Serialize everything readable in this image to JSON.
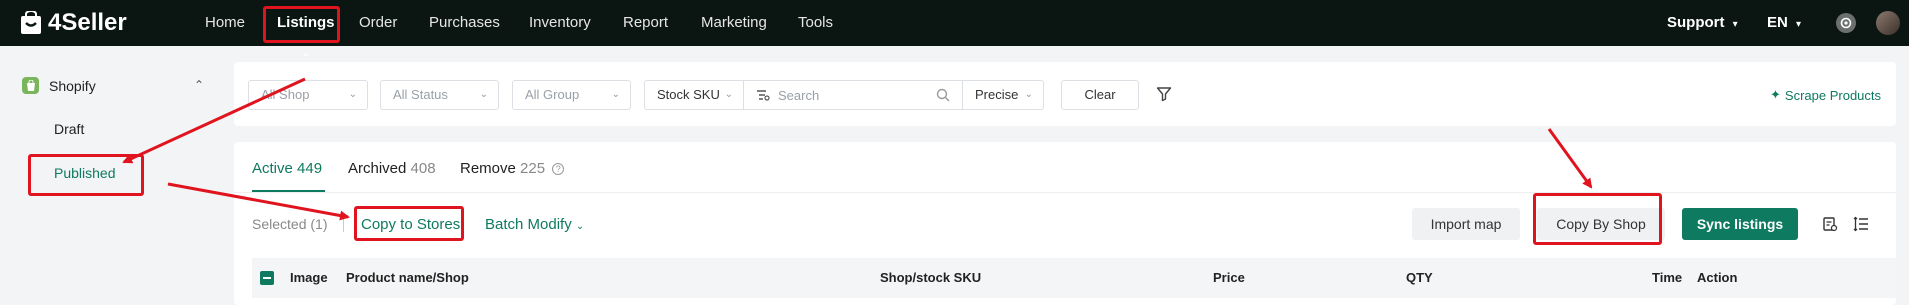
{
  "app": {
    "name": "4Seller"
  },
  "topnav": {
    "items": [
      {
        "label": "Home"
      },
      {
        "label": "Listings"
      },
      {
        "label": "Order"
      },
      {
        "label": "Purchases"
      },
      {
        "label": "Inventory"
      },
      {
        "label": "Report"
      },
      {
        "label": "Marketing"
      },
      {
        "label": "Tools"
      }
    ],
    "active": "Listings",
    "support_label": "Support",
    "language_label": "EN"
  },
  "sidebar": {
    "platform": "Shopify",
    "items": [
      {
        "label": "Draft"
      },
      {
        "label": "Published"
      }
    ],
    "active": "Published"
  },
  "filters": {
    "shop": "All Shop",
    "status": "All Status",
    "group": "All Group",
    "search_field": "Stock SKU",
    "search_placeholder": "Search",
    "match_mode": "Precise",
    "clear_label": "Clear",
    "scrape_label": "Scrape Products"
  },
  "tabs": [
    {
      "label": "Active",
      "count": "449"
    },
    {
      "label": "Archived",
      "count": "408"
    },
    {
      "label": "Remove",
      "count": "225"
    }
  ],
  "toolbar": {
    "selected_label": "Selected (1)",
    "copy_to_stores_label": "Copy to Stores",
    "batch_modify_label": "Batch Modify",
    "import_map_label": "Import map",
    "copy_by_shop_label": "Copy By Shop",
    "sync_listings_label": "Sync listings"
  },
  "table": {
    "columns": [
      "Image",
      "Product name/Shop",
      "Shop/stock SKU",
      "Price",
      "QTY",
      "Time",
      "Action"
    ]
  },
  "colors": {
    "brand_green": "#0e7a5f",
    "topbar": "#0b1613",
    "annotation_red": "#e0141e"
  }
}
